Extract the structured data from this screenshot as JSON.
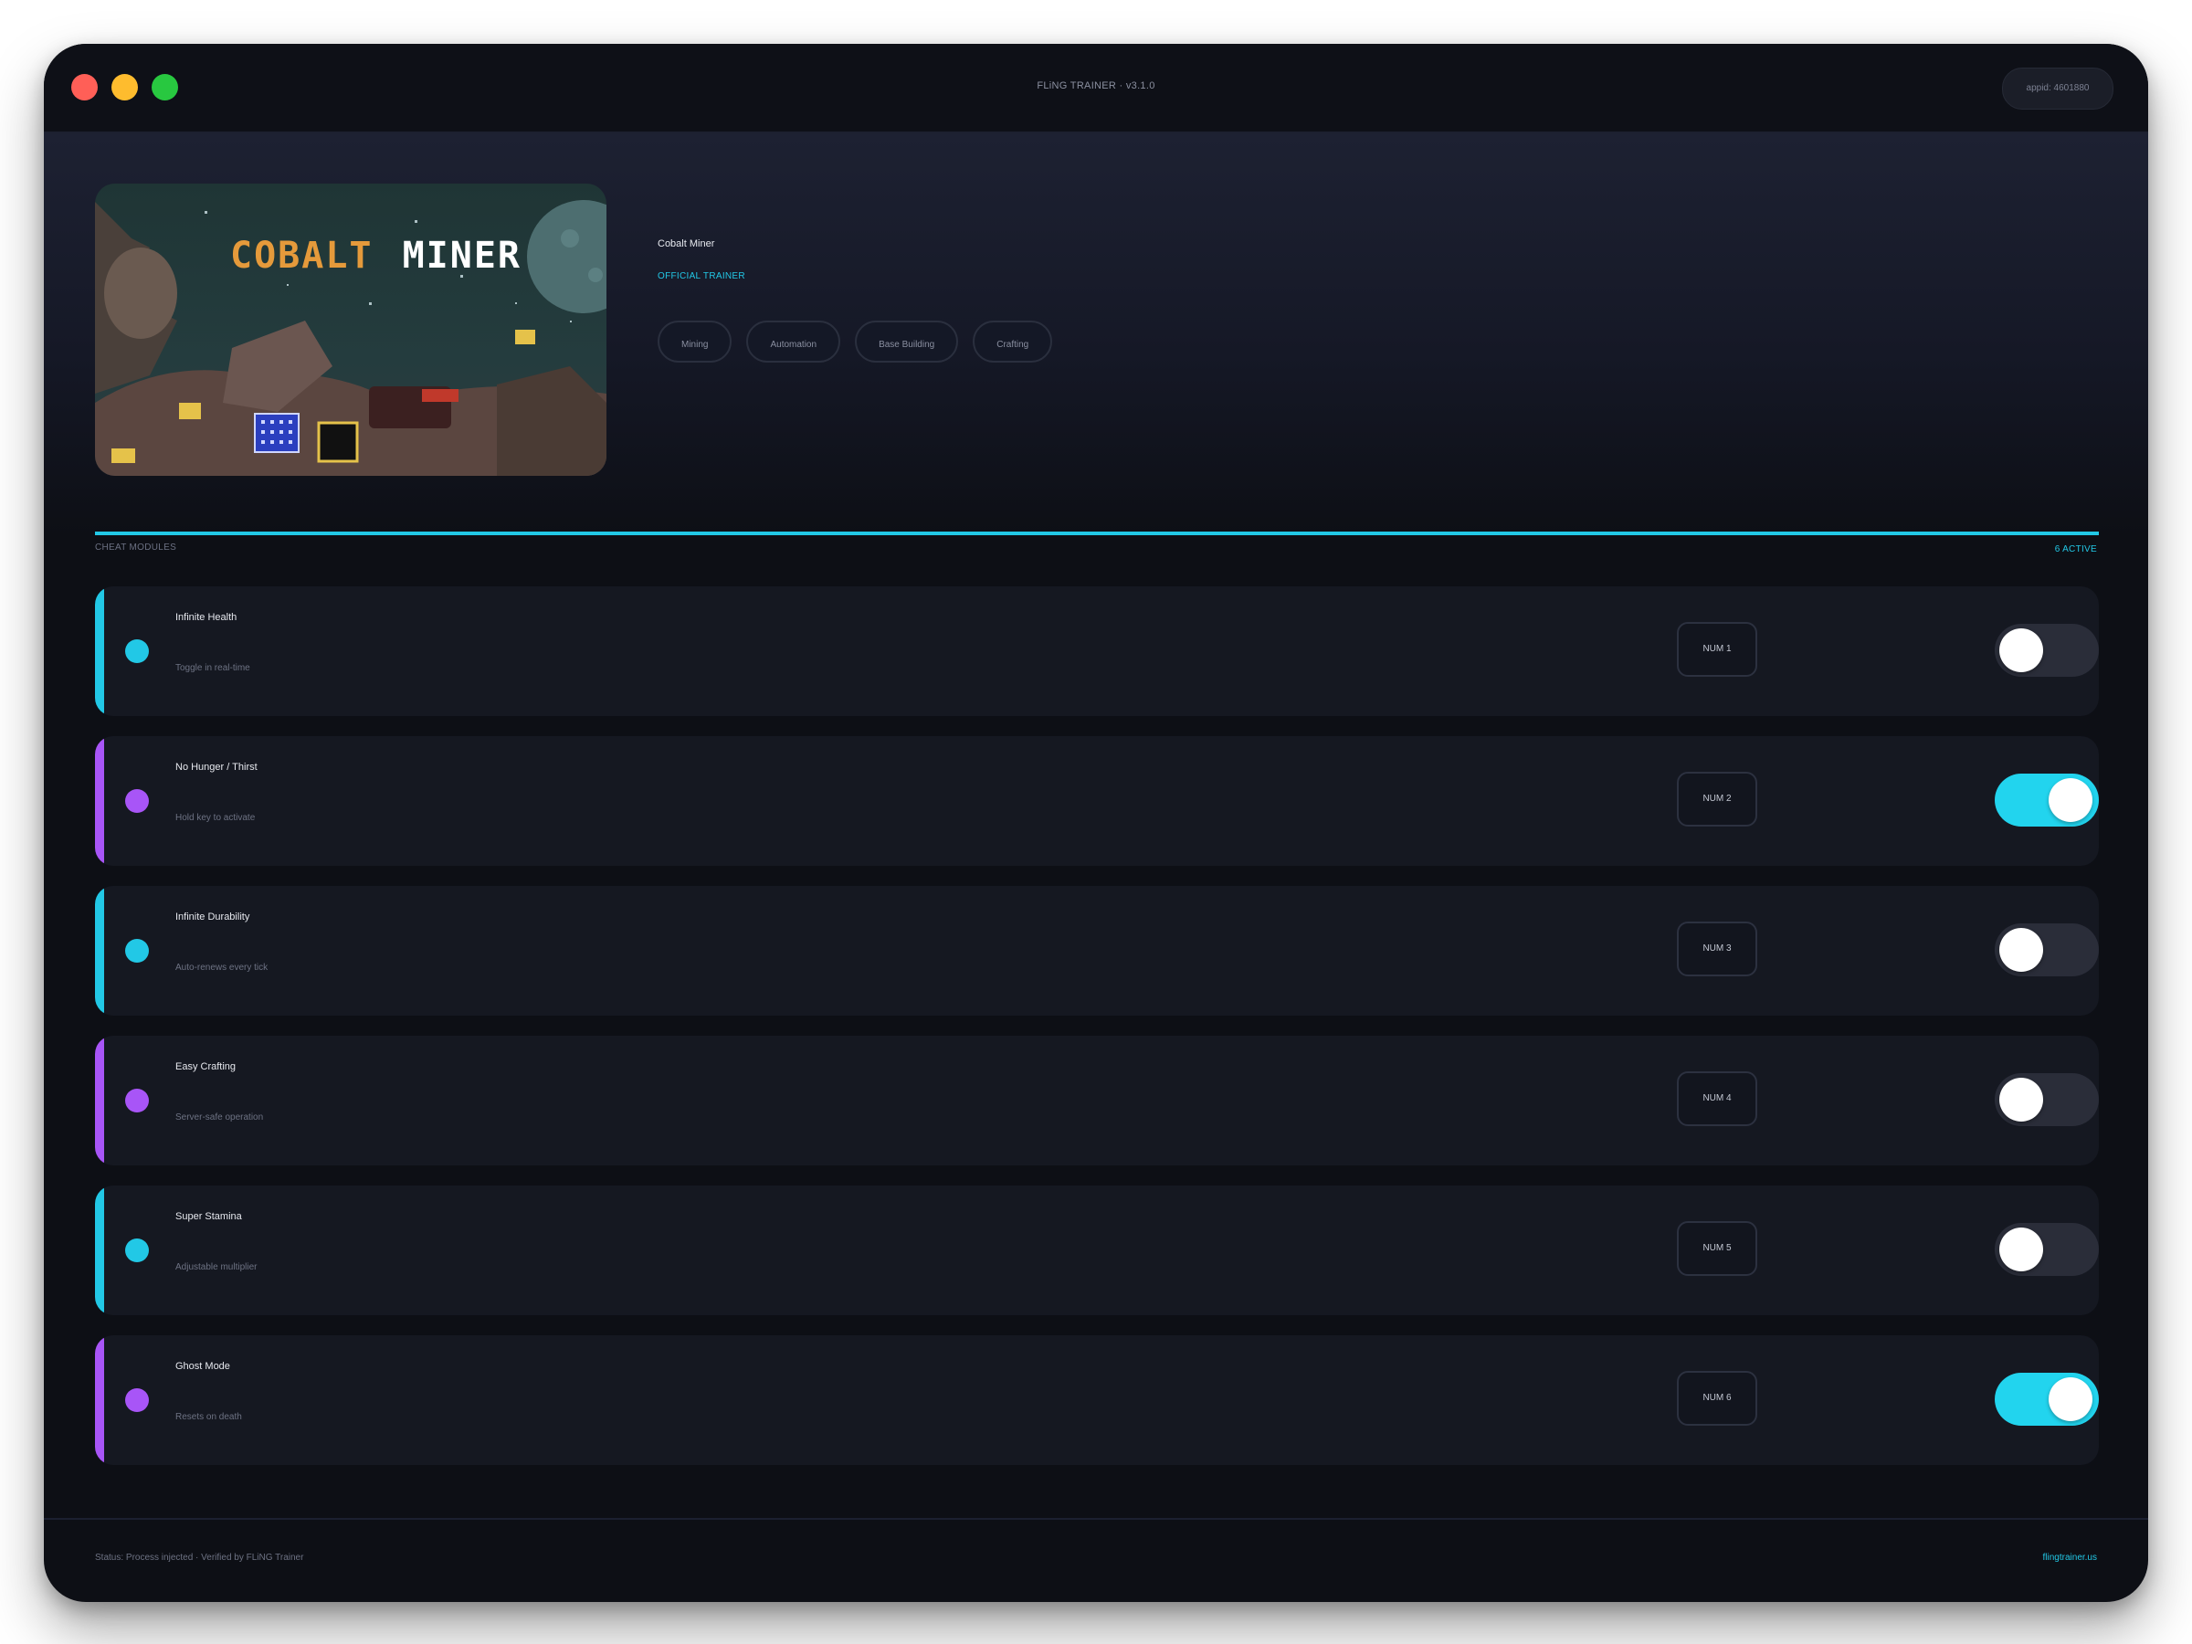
{
  "window": {
    "title": "FLiNG TRAINER · v3.1.0",
    "appid": "appid: 4601880"
  },
  "game": {
    "cover_title_part1": "COBALT",
    "cover_title_part2": "MINER",
    "name": "Cobalt Miner",
    "badge": "OFFICIAL TRAINER",
    "tags": [
      "Mining",
      "Automation",
      "Base Building",
      "Crafting"
    ]
  },
  "section": {
    "label": "CHEAT MODULES",
    "count": "6 ACTIVE"
  },
  "cheats": [
    {
      "name": "Infinite Health",
      "desc": "Toggle in real-time",
      "key": "NUM 1",
      "enabled": false,
      "accent": "#22c8e6"
    },
    {
      "name": "No Hunger / Thirst",
      "desc": "Hold key to activate",
      "key": "NUM 2",
      "enabled": true,
      "accent": "#a855f7"
    },
    {
      "name": "Infinite Durability",
      "desc": "Auto-renews every tick",
      "key": "NUM 3",
      "enabled": false,
      "accent": "#22c8e6"
    },
    {
      "name": "Easy Crafting",
      "desc": "Server-safe operation",
      "key": "NUM 4",
      "enabled": false,
      "accent": "#a855f7"
    },
    {
      "name": "Super Stamina",
      "desc": "Adjustable multiplier",
      "key": "NUM 5",
      "enabled": false,
      "accent": "#22c8e6"
    },
    {
      "name": "Ghost Mode",
      "desc": "Resets on death",
      "key": "NUM 6",
      "enabled": true,
      "accent": "#a855f7"
    }
  ],
  "footer": {
    "status": "Status: Process injected · Verified by FLiNG Trainer",
    "site": "flingtrainer.us"
  },
  "colors": {
    "cyan": "#22c8e6",
    "purple": "#a855f7",
    "toggle_on": "#22d4ee",
    "toggle_off": "#2a2d39"
  }
}
